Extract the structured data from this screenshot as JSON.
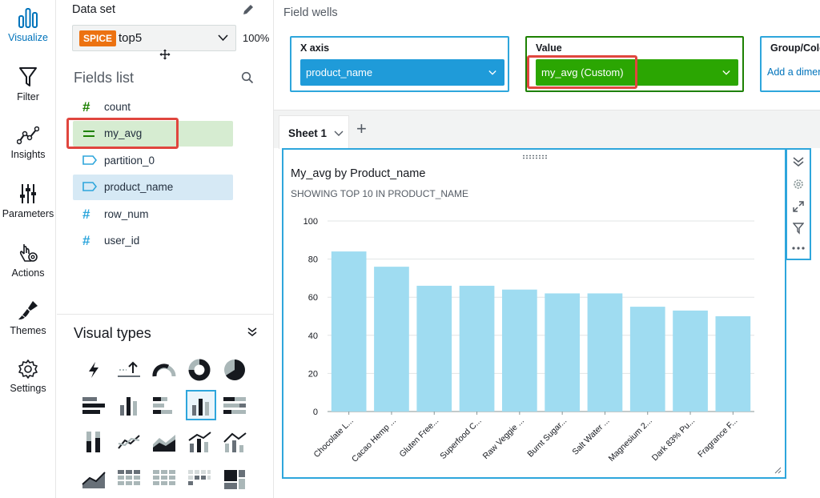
{
  "nav": {
    "items": [
      {
        "label": "Visualize",
        "icon": "bar-chart-icon",
        "active": true
      },
      {
        "label": "Filter",
        "icon": "filter-icon"
      },
      {
        "label": "Insights",
        "icon": "insights-icon"
      },
      {
        "label": "Parameters",
        "icon": "parameters-icon"
      },
      {
        "label": "Actions",
        "icon": "actions-icon"
      },
      {
        "label": "Themes",
        "icon": "themes-icon"
      },
      {
        "label": "Settings",
        "icon": "settings-icon"
      }
    ]
  },
  "dataset": {
    "label": "Data set",
    "badge": "SPICE",
    "name": "top5",
    "percent": "100%"
  },
  "fields": {
    "title": "Fields list",
    "items": [
      {
        "name": "count",
        "type": "measure"
      },
      {
        "name": "my_avg",
        "type": "calculated"
      },
      {
        "name": "partition_0",
        "type": "dimension"
      },
      {
        "name": "product_name",
        "type": "dimension"
      },
      {
        "name": "row_num",
        "type": "measure"
      },
      {
        "name": "user_id",
        "type": "measure"
      }
    ]
  },
  "visual_types": {
    "title": "Visual types"
  },
  "wells": {
    "title": "Field wells",
    "x_axis": {
      "label": "X axis",
      "value": "product_name"
    },
    "value": {
      "label": "Value",
      "value": "my_avg (Custom)"
    },
    "group": {
      "label": "Group/Colo",
      "placeholder": "Add a dimer"
    }
  },
  "sheet": {
    "tab": "Sheet 1",
    "add": "+"
  },
  "colors": {
    "accent": "#2ea6dc",
    "bar": "#9fdcf1",
    "measure_green": "#1d8102",
    "dimension_blue": "#2ea6dc",
    "highlight_red": "#e0463e"
  },
  "chart_data": {
    "type": "bar",
    "title": "My_avg by Product_name",
    "subtitle": "SHOWING TOP 10 IN PRODUCT_NAME",
    "categories": [
      "Chocolate L...",
      "Cacao Hemp ...",
      "Gluten Free...",
      "Superfood C...",
      "Raw Veggie ...",
      "Burnt Sugar...",
      "Salt Water ...",
      "Magnesium 2...",
      "Dark 83% Pu...",
      "Fragrance F..."
    ],
    "values": [
      84,
      76,
      66,
      66,
      64,
      62,
      62,
      55,
      53,
      50
    ],
    "ylim": [
      0,
      100
    ],
    "yticks": [
      "0",
      "20",
      "40",
      "60",
      "80",
      "100"
    ],
    "grid": true
  }
}
